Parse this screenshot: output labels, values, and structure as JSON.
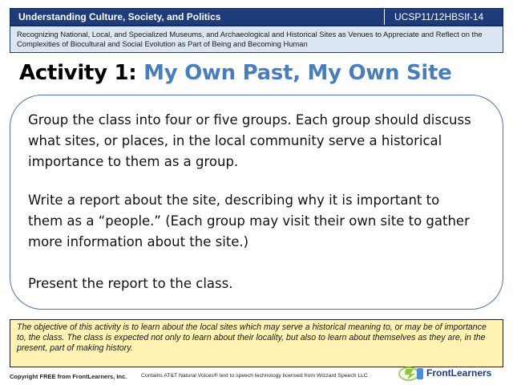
{
  "header": {
    "title": "Understanding Culture, Society, and Politics",
    "code": "UCSP11/12HBSIf-14"
  },
  "competency": "Recognizing  National,  Local, and Specialized Museums,  and Archaeological and Historical Sites as Venues to Appreciate and Reflect on the Complexities  of Biocultural  and Social Evolution  as Part of Being and Becoming  Human",
  "activity": {
    "label": "Activity 1:",
    "title": "My Own Past, My Own Site"
  },
  "content": {
    "paragraph_1": "Group the class into four or five groups. Each group should discuss what sites, or places,  in the local community serve  a historical importance to them as a group.",
    "paragraph_2": "Write a report about the site, describing why it is important to them as a “people.”  (Each group may visit their own site to gather more information about the site.)",
    "paragraph_3": "Present the report to the class."
  },
  "note": "The objective of this activity is to learn about the local sites which may serve a historical meaning to, or may be of importance to, the class. The class is expected not only to learn about their locality, but also to learn about themselves as they are, in the present, part of making history.",
  "footer": {
    "copyright": "Copyright FREE from FrontLearners, Inc.",
    "voices": "Contains AT&T Natural Voices® text to speech technology licensed from Wizzard Speech LLC",
    "logo_text": "FrontLearners"
  },
  "colors": {
    "header_bg": "#1f3c7a",
    "competency_bg": "#dce6f2",
    "title_accent": "#4a7ebb",
    "note_bg": "#fff2b3"
  }
}
